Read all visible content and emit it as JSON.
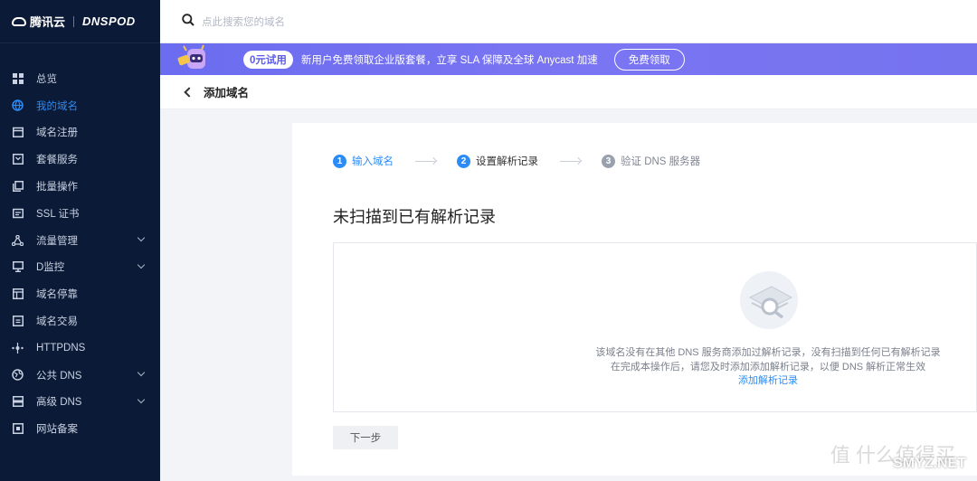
{
  "brand": {
    "tencent": "腾讯云",
    "dnspod": "DNSPOD"
  },
  "search": {
    "placeholder": "点此搜索您的域名"
  },
  "sidebar": {
    "items": [
      {
        "label": "总览",
        "icon": "grid-icon"
      },
      {
        "label": "我的域名",
        "icon": "globe-icon"
      },
      {
        "label": "域名注册",
        "icon": "calendar-icon"
      },
      {
        "label": "套餐服务",
        "icon": "package-icon"
      },
      {
        "label": "批量操作",
        "icon": "copy-icon"
      },
      {
        "label": "SSL 证书",
        "icon": "certificate-icon"
      },
      {
        "label": "流量管理",
        "icon": "network-icon"
      },
      {
        "label": "D监控",
        "icon": "monitor-icon"
      },
      {
        "label": "域名停靠",
        "icon": "window-icon"
      },
      {
        "label": "域名交易",
        "icon": "trade-icon"
      },
      {
        "label": "HTTPDNS",
        "icon": "nodes-icon"
      },
      {
        "label": "公共 DNS",
        "icon": "public-globe-icon"
      },
      {
        "label": "高级 DNS",
        "icon": "server-icon"
      },
      {
        "label": "网站备案",
        "icon": "record-icon"
      }
    ],
    "active_index": 1
  },
  "banner": {
    "badge": "0元试用",
    "text": "新用户免费领取企业版套餐，立享 SLA 保障及全球 Anycast 加速",
    "button": "免费领取"
  },
  "page": {
    "title": "添加域名"
  },
  "steps": [
    {
      "num": "1",
      "label": "输入域名"
    },
    {
      "num": "2",
      "label": "设置解析记录"
    },
    {
      "num": "3",
      "label": "验证 DNS 服务器"
    }
  ],
  "content": {
    "heading": "未扫描到已有解析记录",
    "empty_line1": "该域名没有在其他 DNS 服务商添加过解析记录，没有扫描到任何已有解析记录",
    "empty_line2": "在完成本操作后，请您及时添加添加解析记录，以便 DNS 解析正常生效",
    "link": "添加解析记录",
    "next": "下一步"
  },
  "watermark": {
    "text": "SMYZ.NET",
    "zh": "值 什么值得买"
  },
  "colors": {
    "sidebar_bg": "#0b1a36",
    "accent": "#2b8cf8",
    "banner": "#6b6cf0"
  }
}
